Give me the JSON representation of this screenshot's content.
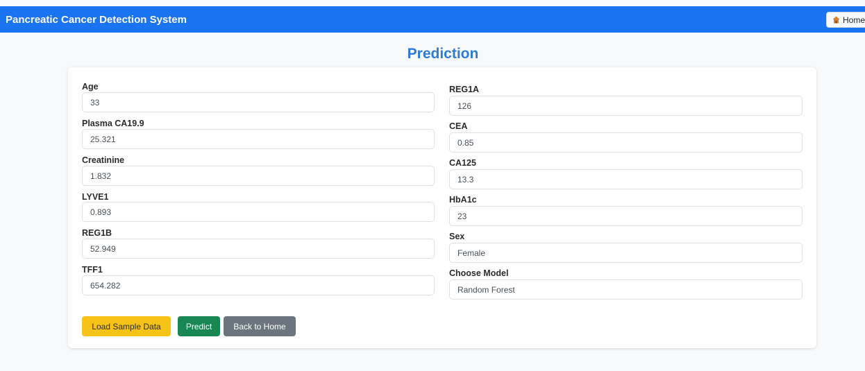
{
  "navbar": {
    "brand": "Pancreatic Cancer Detection System",
    "home_label": "Home"
  },
  "page": {
    "title": "Prediction"
  },
  "form": {
    "left": [
      {
        "label": "Age",
        "value": "33"
      },
      {
        "label": "Plasma CA19.9",
        "value": "25.321"
      },
      {
        "label": "Creatinine",
        "value": "1.832"
      },
      {
        "label": "LYVE1",
        "value": "0.893"
      },
      {
        "label": "REG1B",
        "value": "52.949"
      },
      {
        "label": "TFF1",
        "value": "654.282"
      }
    ],
    "right": [
      {
        "label": "REG1A",
        "value": "126"
      },
      {
        "label": "CEA",
        "value": "0.85"
      },
      {
        "label": "CA125",
        "value": "13.3"
      },
      {
        "label": "HbA1c",
        "value": "23"
      },
      {
        "label": "Sex",
        "value": "Female"
      },
      {
        "label": "Choose Model",
        "value": "Random Forest"
      }
    ]
  },
  "buttons": {
    "load_sample": "Load Sample Data",
    "predict": "Predict",
    "back_home": "Back to Home"
  },
  "icons": {
    "home": "house-icon"
  },
  "colors": {
    "navbar": "#1a73f0",
    "title": "#2f7bd9",
    "warning": "#f7c316",
    "success": "#198754",
    "secondary": "#6c757d"
  }
}
